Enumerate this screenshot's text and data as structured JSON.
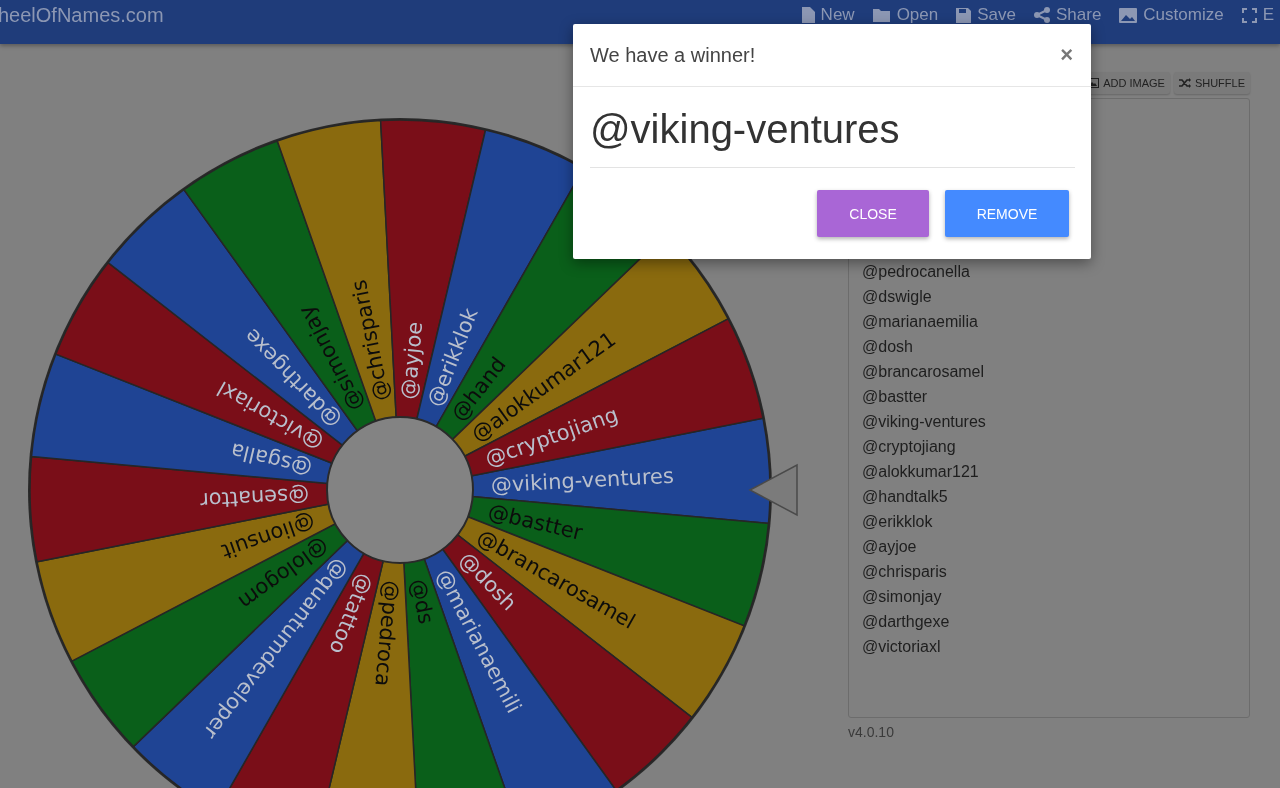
{
  "top_bar": {
    "site_title": "heelOfNames.com",
    "menu": [
      {
        "label": "New"
      },
      {
        "label": "Open"
      },
      {
        "label": "Save"
      },
      {
        "label": "Share"
      },
      {
        "label": "Customize"
      },
      {
        "label": "E"
      }
    ]
  },
  "wheel": {
    "slices": [
      {
        "label": "@viking-ventures",
        "color": "#1f4494"
      },
      {
        "label": "@bastter",
        "color": "#0a5f1a"
      },
      {
        "label": "@brancarosamel",
        "color": "#8a6a0e"
      },
      {
        "label": "@dosh",
        "color": "#7a0e18"
      },
      {
        "label": "@marianaemili",
        "color": "#1f4494"
      },
      {
        "label": "@ds",
        "color": "#0a5f1a"
      },
      {
        "label": "@pedroca",
        "color": "#8a6a0e"
      },
      {
        "label": "@tattoo",
        "color": "#7a0e18"
      },
      {
        "label": "@quantumdeveloper",
        "color": "#1f4494"
      },
      {
        "label": "@lologom",
        "color": "#0a5f1a"
      },
      {
        "label": "@lionsuit",
        "color": "#8a6a0e"
      },
      {
        "label": "@senattor",
        "color": "#7a0e18"
      },
      {
        "label": "@sgalla",
        "color": "#1f4494"
      },
      {
        "label": "@victoriaxl",
        "color": "#7a0e18"
      },
      {
        "label": "@darthgexe",
        "color": "#1f4494"
      },
      {
        "label": "@simonjay",
        "color": "#0a5f1a"
      },
      {
        "label": "@chrisparis",
        "color": "#8a6a0e"
      },
      {
        "label": "@ayjoe",
        "color": "#7a0e18"
      },
      {
        "label": "@erikklok",
        "color": "#1f4494"
      },
      {
        "label": "@hand",
        "color": "#0a5f1a"
      },
      {
        "label": "@alokkumar121",
        "color": "#8a6a0e"
      },
      {
        "label": "@cryptojiang",
        "color": "#7a0e18"
      }
    ]
  },
  "entries_panel": {
    "buttons": [
      "ADD IMAGE",
      "SHUFFLE"
    ],
    "entries": [
      "@pedrocanella",
      "@dswigle",
      "@marianaemilia",
      "@dosh",
      "@brancarosamel",
      "@bastter",
      "@viking-ventures",
      "@cryptojiang",
      "@alokkumar121",
      "@handtalk5",
      "@erikklok",
      "@ayjoe",
      "@chrisparis",
      "@simonjay",
      "@darthgexe",
      "@victoriaxl"
    ],
    "version": "v4.0.10"
  },
  "dialog": {
    "title": "We have a winner!",
    "close_symbol": "×",
    "winner": "@viking-ventures",
    "buttons": [
      "CLOSE",
      "REMOVE"
    ]
  }
}
